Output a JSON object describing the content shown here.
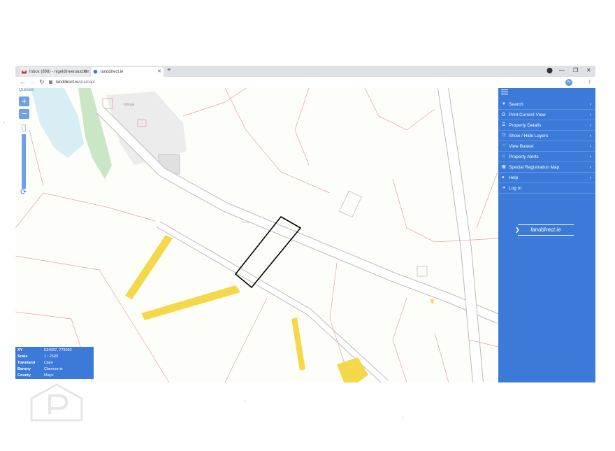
{
  "browser": {
    "tabs": [
      {
        "title": "Inbox (898) - nigeldineenauction"
      },
      {
        "title": "landdirect.ie"
      }
    ],
    "new_tab": "+",
    "window_controls": {
      "minimize": "—",
      "maximize": "❐",
      "close": "✕"
    },
    "address": {
      "domain": "landdirect.ie",
      "path": "/pramap/"
    },
    "avatar_letter": "N"
  },
  "map": {
    "zoom_label": "Queries",
    "zoom_in": "+",
    "zoom_out": "−",
    "place_label": "Kiltoge",
    "colors": {
      "road": "#f5d84a",
      "parcel_outline": "#000000",
      "boundary": "#e8a0a0"
    }
  },
  "sidebar": {
    "items": [
      {
        "label": "Search",
        "icon": "search-icon",
        "glyph": "▼"
      },
      {
        "label": "Print Current View",
        "icon": "print-icon",
        "glyph": "⎙"
      },
      {
        "label": "Property Details",
        "icon": "list-icon",
        "glyph": "☰"
      },
      {
        "label": "Show / Hide Layers",
        "icon": "layers-icon",
        "glyph": "❐"
      },
      {
        "label": "View Basket",
        "icon": "basket-icon",
        "glyph": "🛒"
      },
      {
        "label": "Property Alerts",
        "icon": "bell-icon",
        "glyph": "♫"
      },
      {
        "label": "Special Registration Map",
        "icon": "map-icon",
        "glyph": "▦"
      },
      {
        "label": "Help",
        "icon": "help-icon",
        "glyph": "●"
      },
      {
        "label": "Log In",
        "icon": "login-icon",
        "glyph": "➜"
      }
    ],
    "chevron": "›",
    "logo_text": "landdirect.ie"
  },
  "info": {
    "rows": [
      {
        "key": "XY",
        "value": "534987, 773992"
      },
      {
        "key": "Scale",
        "value": "1 : 2500"
      },
      {
        "key": "Townland",
        "value": "Clare"
      },
      {
        "key": "Barony",
        "value": "Clanmorris"
      },
      {
        "key": "County",
        "value": "Mayo"
      }
    ]
  }
}
